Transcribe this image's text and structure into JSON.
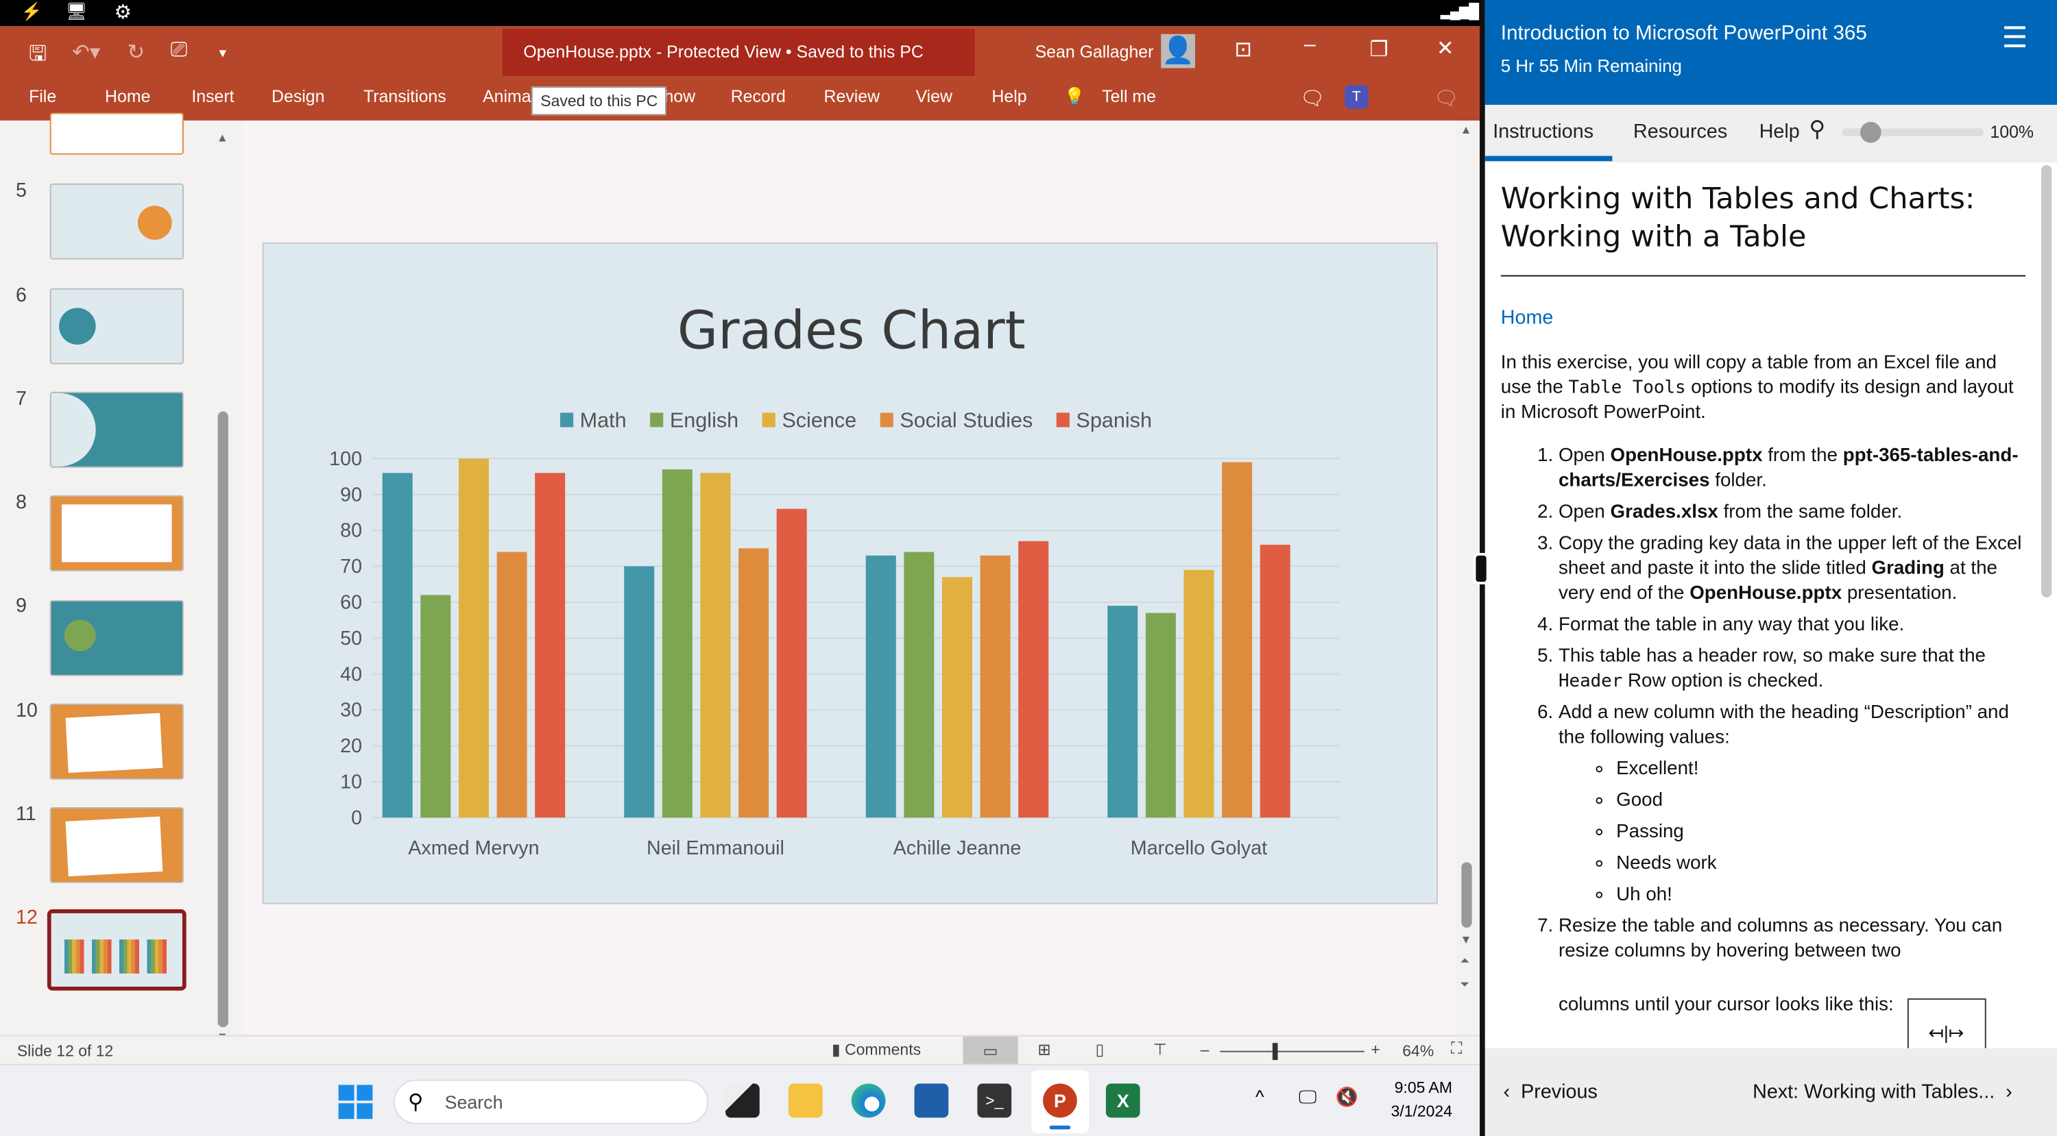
{
  "powerpoint": {
    "doc_title": "OpenHouse.pptx  -  Protected View  •  Saved to this PC",
    "tooltip": "Saved to this PC",
    "user_name": "Sean Gallagher",
    "ribbon_tabs": [
      "File",
      "Home",
      "Insert",
      "Design",
      "Transitions",
      "Animations",
      "Slide Show",
      "Record",
      "Review",
      "View",
      "Help",
      "Tell me"
    ],
    "brand_color": "#b7472a",
    "slide_numbers": [
      "5",
      "6",
      "7",
      "8",
      "9",
      "10",
      "11",
      "12"
    ],
    "selected_slide": "12",
    "status": {
      "slide_info": "Slide 12 of 12",
      "comments": "Comments",
      "zoom": "64%",
      "zoom_level": 64
    }
  },
  "chart_data": {
    "type": "bar",
    "title": "Grades Chart",
    "categories": [
      "Axmed Mervyn",
      "Neil Emmanouil",
      "Achille Jeanne",
      "Marcello Golyat"
    ],
    "series": [
      {
        "name": "Math",
        "color": "#4397a8",
        "values": [
          96,
          70,
          73,
          59
        ]
      },
      {
        "name": "English",
        "color": "#7ea652",
        "values": [
          62,
          97,
          74,
          57
        ]
      },
      {
        "name": "Science",
        "color": "#e0b040",
        "values": [
          100,
          96,
          67,
          69
        ]
      },
      {
        "name": "Social Studies",
        "color": "#df8b3e",
        "values": [
          74,
          75,
          73,
          99
        ]
      },
      {
        "name": "Spanish",
        "color": "#e05c42",
        "values": [
          96,
          86,
          77,
          76
        ]
      }
    ],
    "yticks": [
      "0",
      "10",
      "20",
      "30",
      "40",
      "50",
      "60",
      "70",
      "80",
      "90",
      "100"
    ],
    "ylim": [
      0,
      100
    ],
    "grid": true,
    "legend": "top"
  },
  "taskbar": {
    "search_placeholder": "Search",
    "time": "9:05 AM",
    "date": "3/1/2024"
  },
  "panel": {
    "course_title": "Introduction to Microsoft PowerPoint 365",
    "remaining": "5 Hr 55 Min Remaining",
    "tabs": [
      "Instructions",
      "Resources",
      "Help"
    ],
    "font_zoom": "100%",
    "font_zoom_level": 100,
    "heading": "Working with Tables and Charts: Working with a Table",
    "home_link": "Home",
    "intro": {
      "a": "In this exercise, you will copy a table from an Excel file and use the ",
      "code": "Table Tools",
      "b": " options to modify its design and layout in Microsoft PowerPoint."
    },
    "steps": {
      "s1": {
        "a": "Open ",
        "b1": "OpenHouse.pptx",
        "c": " from the ",
        "b2": "ppt-365-tables-and-charts/Exercises",
        "d": " folder."
      },
      "s2": {
        "a": "Open ",
        "b1": "Grades.xlsx",
        "c": " from the same folder."
      },
      "s3": {
        "a": "Copy the grading key data in the upper left of the Excel sheet and paste it into the slide titled ",
        "b1": "Grading",
        "c": " at the very end of the ",
        "b2": "OpenHouse.pptx",
        "d": " presentation."
      },
      "s4": "Format the table in any way that you like.",
      "s5": {
        "a": "This table has a header row, so make sure that the ",
        "code": "Header",
        "b": " Row option is checked."
      },
      "s6": "Add a new column with the heading “Description” and the following values:",
      "s6_values": [
        "Excellent!",
        "Good",
        "Passing",
        "Needs work",
        "Uh oh!"
      ],
      "s7a": "Resize the table and columns as necessary. You can resize columns by hovering between two",
      "s7b": "columns until your cursor looks like this:"
    },
    "prev": "Previous",
    "next": "Next: Working with Tables..."
  }
}
